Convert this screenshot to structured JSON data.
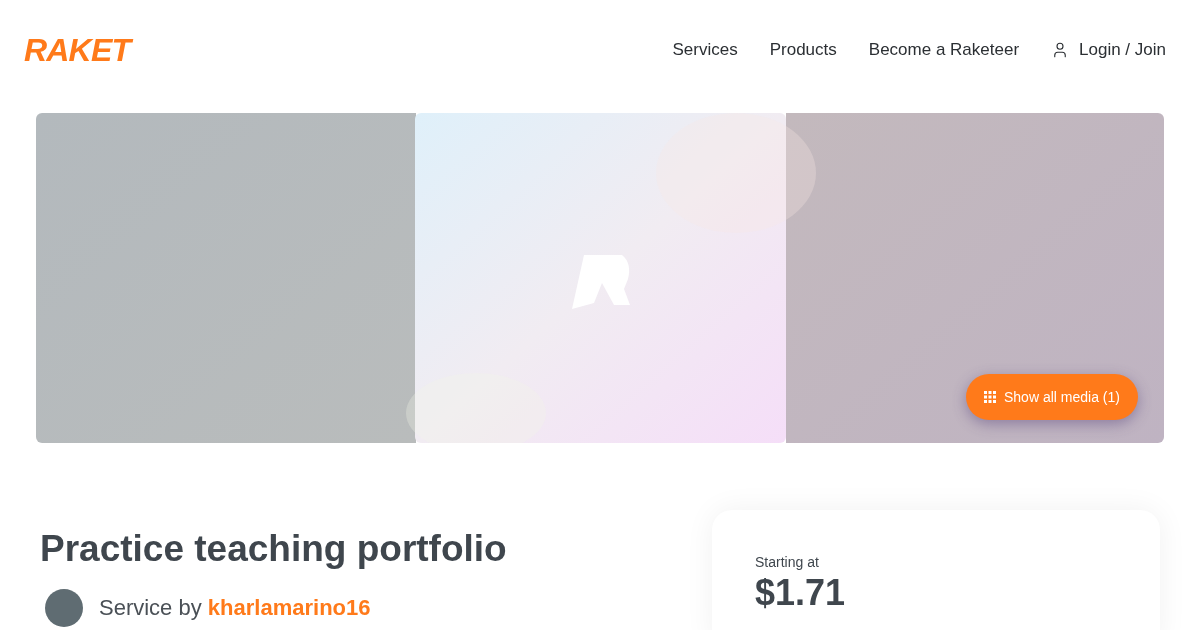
{
  "header": {
    "logo": "RAKET",
    "nav": [
      {
        "label": "Services",
        "kind": "link"
      },
      {
        "label": "Products",
        "kind": "link"
      },
      {
        "label": "Become a Raketeer",
        "kind": "link"
      },
      {
        "label": "Login / Join",
        "kind": "login"
      }
    ]
  },
  "gallery": {
    "kind": "picture",
    "button": "Show all media (1)"
  },
  "service": {
    "title": "Practice teaching portfolio",
    "by_label": "Service by",
    "seller": "kharlamarino16"
  },
  "pricing": {
    "label": "Starting at",
    "price": "$1.71"
  }
}
